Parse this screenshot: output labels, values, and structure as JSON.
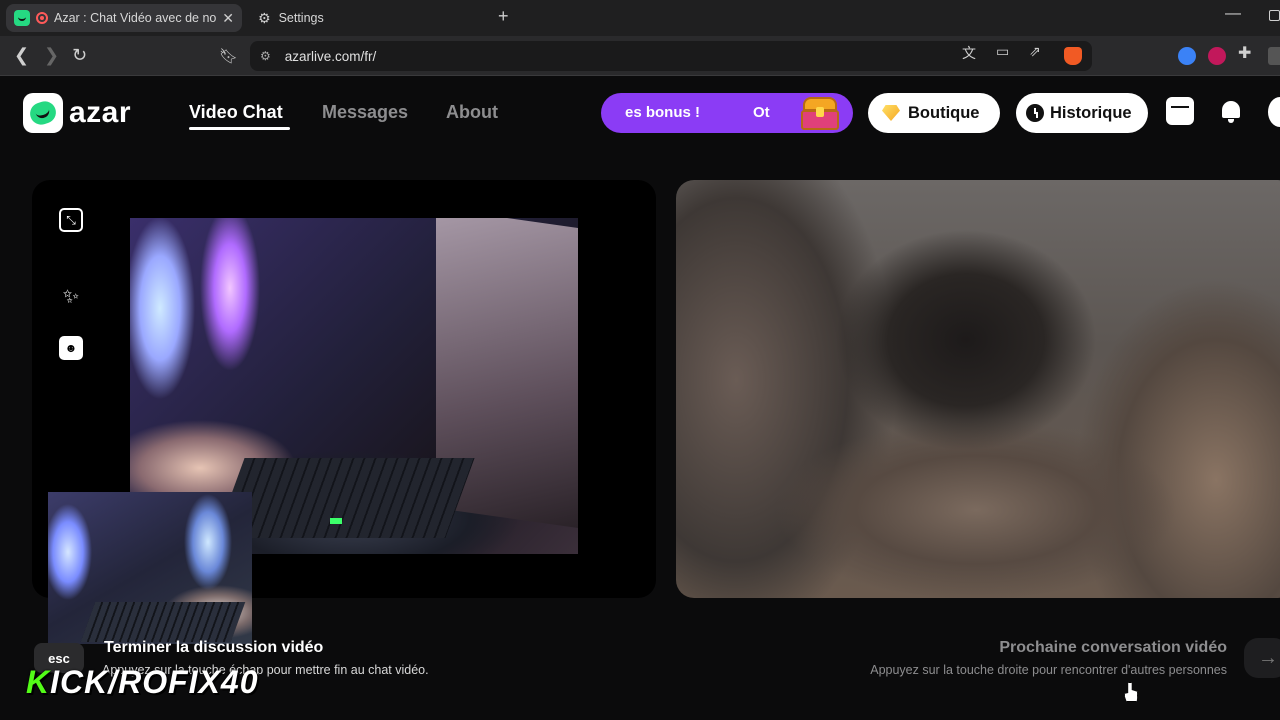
{
  "browser": {
    "tabs": [
      {
        "title": "Azar : Chat Vidéo avec de nou",
        "active": true
      },
      {
        "title": "Settings",
        "active": false
      }
    ],
    "url": "azarlive.com/fr/"
  },
  "header": {
    "logo_text": "azar",
    "nav": [
      {
        "label": "Video Chat",
        "active": true
      },
      {
        "label": "Messages",
        "active": false
      },
      {
        "label": "About",
        "active": false
      }
    ],
    "promo_text": "es bonus !",
    "promo_text2": "Ot",
    "boutique_label": "Boutique",
    "history_label": "Historique"
  },
  "controls": {
    "esc_key": "esc",
    "end_title": "Terminer la discussion vidéo",
    "end_subtitle": "Appuyez sur la touche échap pour mettre fin au chat vidéo.",
    "next_title": "Prochaine conversation vidéo",
    "next_subtitle": "Appuyez sur la touche droite pour rencontrer d'autres personnes",
    "next_arrow": "→"
  },
  "overlay": {
    "watermark_k": "K",
    "watermark_rest": "ICK/ROFIX40"
  },
  "colors": {
    "accent_green": "#25d982",
    "promo_purple": "#8b3cf5",
    "kick_green": "#53fc18"
  }
}
